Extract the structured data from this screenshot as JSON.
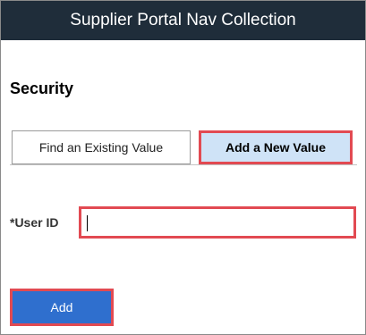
{
  "header": {
    "title": "Supplier Portal Nav Collection"
  },
  "page": {
    "title": "Security"
  },
  "tabs": [
    {
      "label": "Find an Existing Value",
      "active": false
    },
    {
      "label": "Add a New Value",
      "active": true
    }
  ],
  "form": {
    "user_id_label": "*User ID",
    "user_id_value": ""
  },
  "actions": {
    "add_label": "Add"
  },
  "colors": {
    "header_bg": "#1f2d3a",
    "highlight": "#e24a52",
    "active_tab_bg": "#cfe3f7",
    "primary_button": "#2f6fce"
  }
}
